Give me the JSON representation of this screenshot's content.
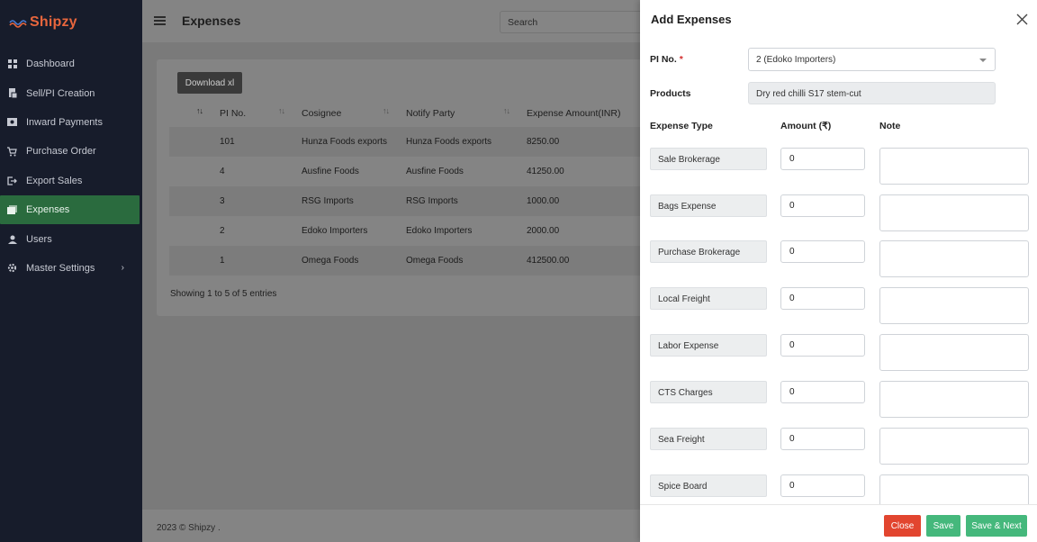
{
  "app": {
    "brand": "Shipzy"
  },
  "sidebar": {
    "items": [
      {
        "label": "Dashboard",
        "icon": "grid-icon"
      },
      {
        "label": "Sell/PI Creation",
        "icon": "document-icon"
      },
      {
        "label": "Inward Payments",
        "icon": "payment-icon"
      },
      {
        "label": "Purchase Order",
        "icon": "cart-icon"
      },
      {
        "label": "Export Sales",
        "icon": "export-icon"
      },
      {
        "label": "Expenses",
        "icon": "expenses-icon",
        "active": true
      },
      {
        "label": "Users",
        "icon": "user-icon"
      },
      {
        "label": "Master Settings",
        "icon": "gear-icon",
        "chevron": "›"
      }
    ]
  },
  "header": {
    "title": "Expenses",
    "search_placeholder": "Search"
  },
  "main": {
    "download_label": "Download xl",
    "columns": [
      "PI No.",
      "Cosignee",
      "Notify Party",
      "Expense Amount(INR)"
    ],
    "rows": [
      {
        "pi": "101",
        "consignee": "Hunza Foods exports",
        "notify": "Hunza Foods exports",
        "amount": "8250.00"
      },
      {
        "pi": "4",
        "consignee": "Ausfine Foods",
        "notify": "Ausfine Foods",
        "amount": "41250.00"
      },
      {
        "pi": "3",
        "consignee": "RSG Imports",
        "notify": "RSG Imports",
        "amount": "1000.00"
      },
      {
        "pi": "2",
        "consignee": "Edoko Importers",
        "notify": "Edoko Importers",
        "amount": "2000.00"
      },
      {
        "pi": "1",
        "consignee": "Omega Foods",
        "notify": "Omega Foods",
        "amount": "412500.00"
      }
    ],
    "entries_text": "Showing 1 to 5 of 5 entries"
  },
  "footer": {
    "copyright": "2023 © Shipzy ."
  },
  "modal": {
    "title": "Add Expenses",
    "pi_label": "PI No.",
    "required_mark": "*",
    "pi_value": "2 (Edoko Importers)",
    "products_label": "Products",
    "products_value": "Dry red chilli S17 stem-cut",
    "col_expense_type": "Expense Type",
    "col_amount": "Amount (₹)",
    "col_note": "Note",
    "expenses": [
      {
        "type": "Sale Brokerage",
        "amount": "0"
      },
      {
        "type": "Bags Expense",
        "amount": "0"
      },
      {
        "type": "Purchase Brokerage",
        "amount": "0"
      },
      {
        "type": "Local Freight",
        "amount": "0"
      },
      {
        "type": "Labor Expense",
        "amount": "0"
      },
      {
        "type": "CTS Charges",
        "amount": "0"
      },
      {
        "type": "Sea Freight",
        "amount": "0"
      },
      {
        "type": "Spice Board",
        "amount": "0"
      }
    ],
    "buttons": {
      "close": "Close",
      "save": "Save",
      "save_next": "Save & Next"
    }
  },
  "colors": {
    "sidebar_bg": "#171c2b",
    "active_bg": "#2a6b3e",
    "accent_orange": "#e8663d",
    "close_red": "#e2452f",
    "save_green": "#45b87c"
  }
}
